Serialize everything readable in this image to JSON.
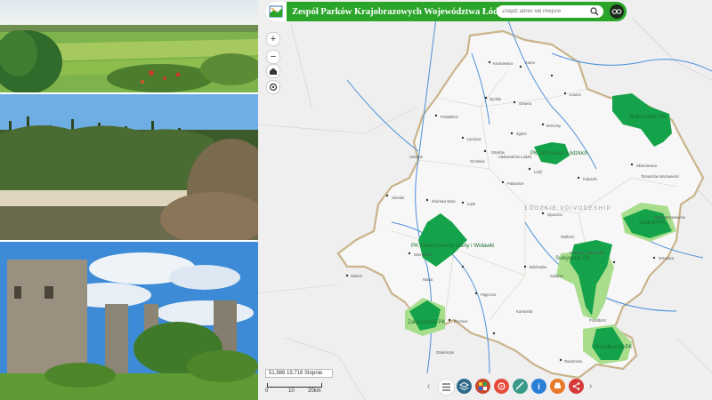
{
  "header": {
    "title": "Zespół Parków Krajobrazowych Województwa Łódzkiego",
    "search_placeholder": "Znajdź adres lub miejsce"
  },
  "map": {
    "zoom_in": "+",
    "zoom_out": "−",
    "region_label": "ŁÓDZKIE VOIVODESHIP",
    "coordinates": "51,986 19,716 Stopnie",
    "scale_labels": [
      "0",
      "10",
      "20km"
    ],
    "parks": [
      {
        "id": "spalski",
        "name": "Spalski PK"
      },
      {
        "id": "wzniesien",
        "name": "PK Wzniesień Łódzkich"
      },
      {
        "id": "bolimowski",
        "name": "Bolimowski PK"
      },
      {
        "id": "miedzyrzecze",
        "name": "PK Międzyrzecza Warty i Widawki"
      },
      {
        "id": "sulejowski",
        "name": "Sulejowski PK"
      },
      {
        "id": "zalecze",
        "name": "Załęczański PK"
      },
      {
        "id": "przedborski",
        "name": "Przedborski PK"
      }
    ],
    "city_labels": [
      "Łódź",
      "Sieradz",
      "Piotrków Trybunalski",
      "Skierniewice",
      "Kutno",
      "Łowicz",
      "Radomsko",
      "Wieluń",
      "Bełchatów",
      "Łęczyca",
      "Zgierz",
      "Pabianice",
      "Opoczno",
      "Tomaszów Mazowiecki",
      "Rawa Mazowiecka",
      "Brzeziny",
      "Koluszki",
      "Zduńska Wola",
      "Łask",
      "Wieruszów",
      "Pajęczno",
      "Poddębice",
      "Uniejów",
      "Żychlin",
      "Stryków",
      "Głowno",
      "Krośniewice",
      "Ozorków",
      "Aleksandrów Łódzki",
      "Sulejów",
      "Wolbórz",
      "Przedbórz",
      "Drzewica",
      "Warta",
      "Złoczew",
      "Działoszyn",
      "Kamieńsk"
    ]
  },
  "icons": {
    "search": "search-icon",
    "view": "binoculars-icon",
    "home": "home-icon",
    "locate": "locate-icon",
    "toolbar": [
      "legend-icon",
      "layers-icon",
      "basemap-icon",
      "bookmark-icon",
      "measure-icon",
      "info-icon",
      "print-icon",
      "share-icon"
    ]
  },
  "colors": {
    "header": "#2aa52a",
    "park": "#14a34a",
    "park_light": "#a8dd8c",
    "border": "#c9b48a",
    "river": "#4a90d9"
  }
}
